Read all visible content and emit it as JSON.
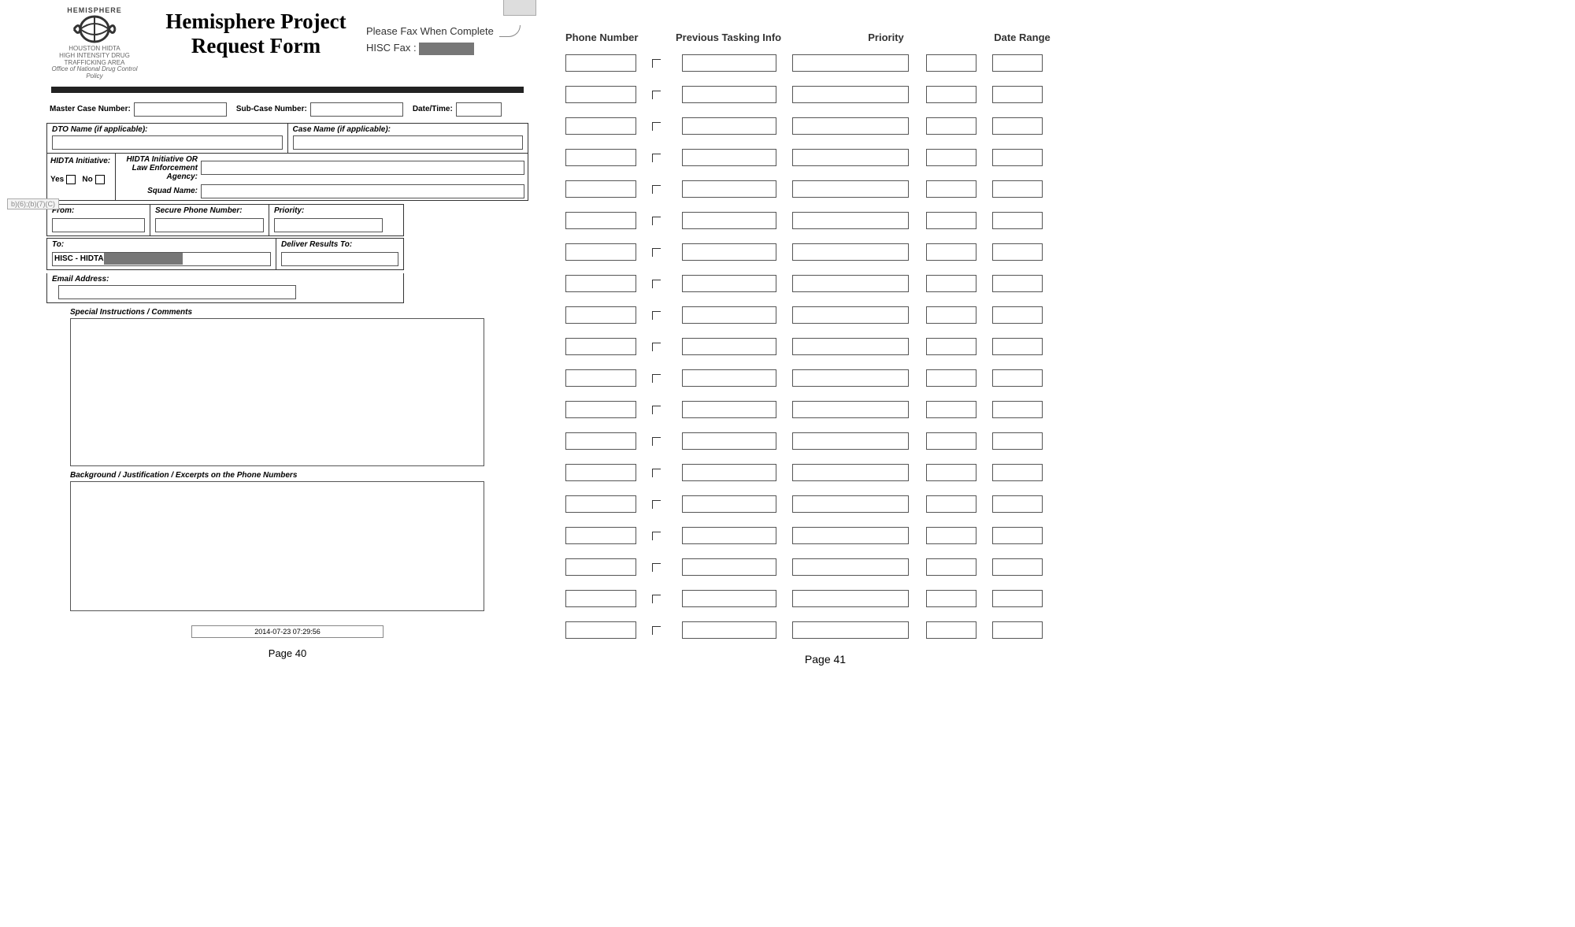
{
  "left": {
    "logo": {
      "top": "HEMISPHERE",
      "org": "HOUSTON HIDTA",
      "org2": "HIGH INTENSITY DRUG TRAFFICKING AREA",
      "org3": "Office of National Drug Control Policy"
    },
    "title1": "Hemisphere Project",
    "title2": "Request Form",
    "fax1": "Please Fax When Complete",
    "fax2": "HISC Fax :",
    "master": "Master Case Number:",
    "sub": "Sub-Case Number:",
    "datetime": "Date/Time:",
    "dto": "DTO Name (if applicable):",
    "casen": "Case Name (if applicable):",
    "hidta": "HIDTA Initiative:",
    "yes": "Yes",
    "no": "No",
    "hidta2": "HIDTA Initiative OR Law Enforcement Agency:",
    "squad": "Squad Name:",
    "from": "From:",
    "secure": "Secure Phone Number:",
    "priority": "Priority:",
    "to": "To:",
    "to_val": "HISC - HIDTA",
    "deliver": "Deliver Results To:",
    "email": "Email Address:",
    "redact_code": "b)(6);(b)(7)(C)",
    "spec": "Special Instructions / Comments",
    "bg": "Background / Justification / Excerpts on the Phone Numbers",
    "ts": "2014-07-23 07:29:56",
    "page": "Page 40"
  },
  "right": {
    "hdr_phone": "Phone Number",
    "hdr_prev": "Previous Tasking Info",
    "hdr_pri": "Priority",
    "hdr_dr": "Date Range",
    "row_count": 19,
    "page": "Page 41"
  }
}
